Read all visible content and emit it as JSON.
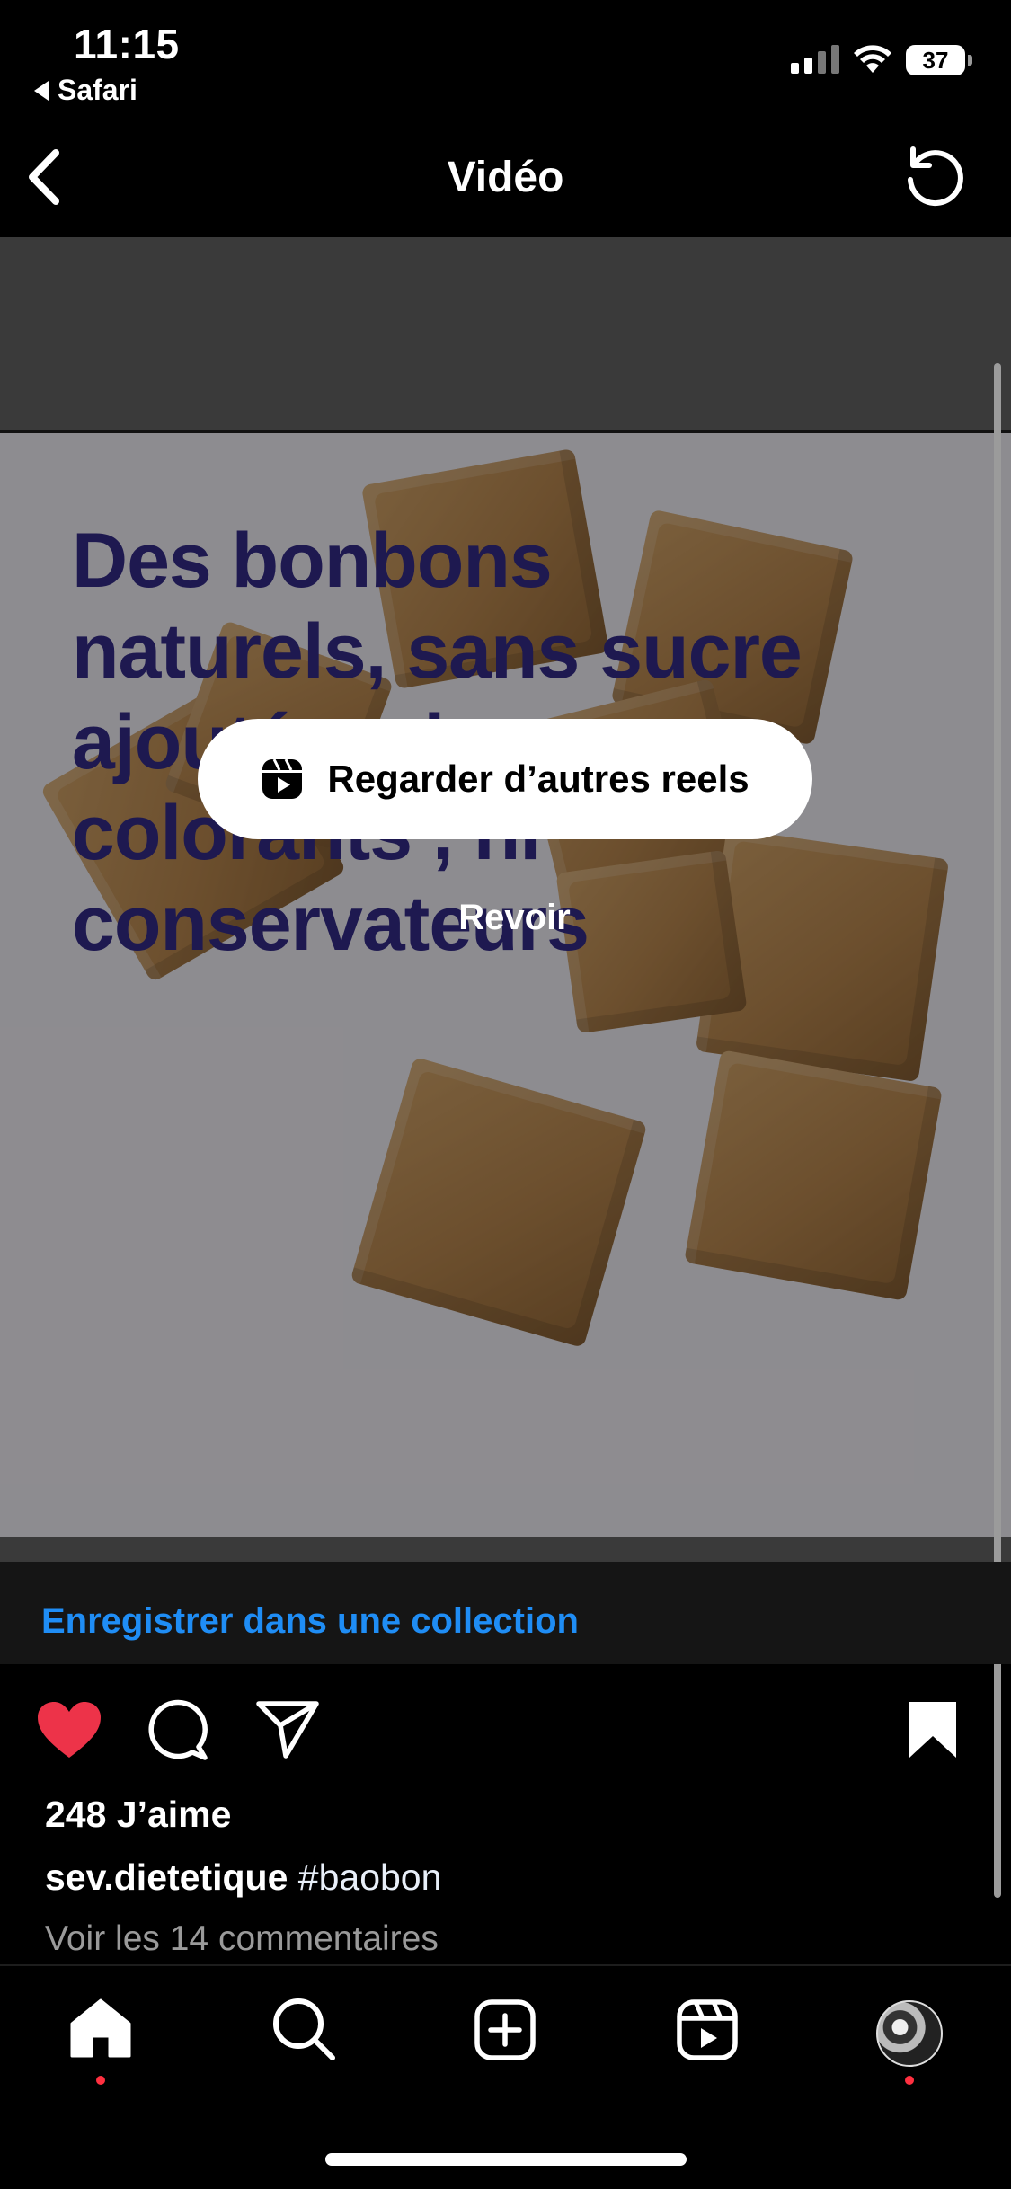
{
  "status_bar": {
    "time": "11:15",
    "back_app": "Safari",
    "battery_percent": "37",
    "battery_level": 0.37,
    "signal_bars_active": 2,
    "icons": [
      "signal-icon",
      "wifi-icon",
      "battery-icon"
    ]
  },
  "header": {
    "title": "Vidéo",
    "back_icon": "chevron-left-icon",
    "reload_icon": "reload-icon"
  },
  "video": {
    "overlay_text_lines": [
      "Des bonbons",
      "naturels, sans sucre",
      "ajoutés, ni",
      "colorants , ni",
      "conservateurs"
    ],
    "reels_button_label": "Regarder d’autres reels",
    "reels_icon": "reels-icon",
    "replay_label": "Revoir"
  },
  "collection": {
    "save_label": "Enregistrer dans une collection"
  },
  "actions": {
    "liked": true,
    "colors": {
      "like": "#ed3349",
      "link": "#1f8df5",
      "notification_dot": "#ff3040"
    },
    "icons": [
      "heart-icon",
      "comment-icon",
      "share-icon",
      "bookmark-icon"
    ]
  },
  "post": {
    "likes": "248 J’aime",
    "username": "sev.dietetique",
    "caption": "#baobon",
    "view_comments": "Voir les 14 commentaires"
  },
  "tabbar": {
    "icons": [
      "home-icon",
      "search-icon",
      "create-icon",
      "reels-tab-icon",
      "profile-avatar"
    ]
  }
}
